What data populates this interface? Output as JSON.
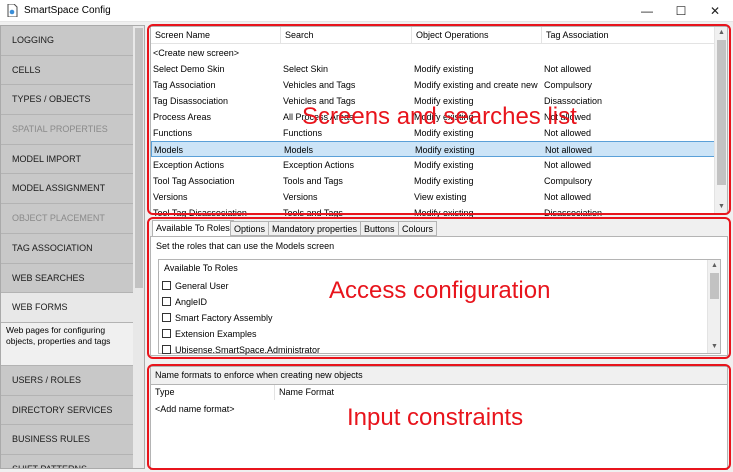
{
  "window": {
    "title": "SmartSpace Config",
    "controls": {
      "minimize": "—",
      "maximize": "☐",
      "close": "✕"
    }
  },
  "sidebar": {
    "items": [
      {
        "label": "LOGGING",
        "state": "normal"
      },
      {
        "label": "CELLS",
        "state": "normal"
      },
      {
        "label": "TYPES / OBJECTS",
        "state": "normal"
      },
      {
        "label": "SPATIAL PROPERTIES",
        "state": "disabled"
      },
      {
        "label": "MODEL IMPORT",
        "state": "normal"
      },
      {
        "label": "MODEL ASSIGNMENT",
        "state": "normal"
      },
      {
        "label": "OBJECT PLACEMENT",
        "state": "disabled"
      },
      {
        "label": "TAG ASSOCIATION",
        "state": "normal"
      },
      {
        "label": "WEB SEARCHES",
        "state": "normal"
      },
      {
        "label": "WEB FORMS",
        "state": "active",
        "description": "Web pages for configuring objects, properties and tags"
      },
      {
        "label": "USERS / ROLES",
        "state": "normal"
      },
      {
        "label": "DIRECTORY SERVICES",
        "state": "normal"
      },
      {
        "label": "BUSINESS RULES",
        "state": "normal"
      },
      {
        "label": "SHIFT PATTERNS",
        "state": "normal"
      }
    ]
  },
  "screens": {
    "columns": [
      "Screen Name",
      "Search",
      "Object Operations",
      "Tag Association"
    ],
    "rows": [
      [
        "<Create new screen>",
        "",
        "",
        ""
      ],
      [
        "Select Demo Skin",
        "Select Skin",
        "Modify existing",
        "Not allowed"
      ],
      [
        "Tag Association",
        "Vehicles and Tags",
        "Modify existing and create new",
        "Compulsory"
      ],
      [
        "Tag Disassociation",
        "Vehicles and Tags",
        "Modify existing",
        "Disassociation"
      ],
      [
        "Process Areas",
        "All Process Areas",
        "Modify existing",
        "Not allowed"
      ],
      [
        "Functions",
        "Functions",
        "Modify existing",
        "Not allowed"
      ],
      [
        "Models",
        "Models",
        "Modify existing",
        "Not allowed"
      ],
      [
        "Exception Actions",
        "Exception Actions",
        "Modify existing",
        "Not allowed"
      ],
      [
        "Tool Tag Association",
        "Tools and Tags",
        "Modify existing",
        "Compulsory"
      ],
      [
        "Versions",
        "Versions",
        "View existing",
        "Not allowed"
      ],
      [
        "Tool Tag Disassociation",
        "Tools and Tags",
        "Modify existing",
        "Disassociation"
      ]
    ],
    "selected_row": "Models"
  },
  "tabs": {
    "items": [
      "Available To Roles",
      "Options",
      "Mandatory properties",
      "Buttons",
      "Colours"
    ],
    "active": "Available To Roles"
  },
  "roles": {
    "description": "Set the roles that can use the Models screen",
    "header": "Available To Roles",
    "items": [
      {
        "label": "General User",
        "checked": false
      },
      {
        "label": "AngleID",
        "checked": false
      },
      {
        "label": "Smart Factory Assembly",
        "checked": false
      },
      {
        "label": "Extension Examples",
        "checked": false
      },
      {
        "label": "Ubisense.SmartSpace.Administrator",
        "checked": false
      }
    ]
  },
  "name_formats": {
    "group_label": "Name formats to enforce when creating new objects",
    "columns": [
      "Type",
      "Name Format"
    ],
    "add_row": "<Add name format>"
  },
  "annotations": {
    "top": "Screens and searches list",
    "middle": "Access configuration",
    "bottom": "Input constraints",
    "color": "#e8141c"
  }
}
